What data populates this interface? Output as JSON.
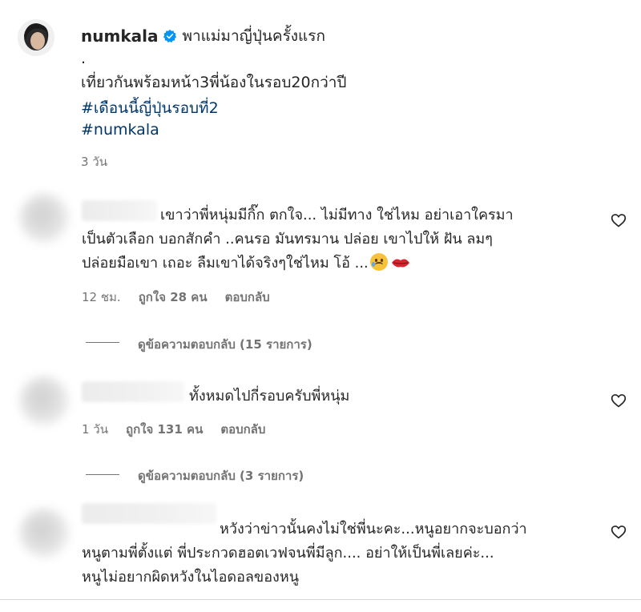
{
  "post": {
    "username": "numkala",
    "title": "พาแม่มาญี่ปุ่นครั้งแรก",
    "dot": ".",
    "caption": "เที่ยวกันพร้อมหน้า3พี่น้องในรอบ20กว่าปี",
    "hashtag1": "#เดือนนี้ญี่ปุ่นรอบที่2",
    "hashtag2": "#numkala",
    "time": "3 วัน"
  },
  "comments": [
    {
      "lines": [
        "เขาว่าพี่หนุ่มมีกิ๊ก ตกใจ... ไม่มีทาง ใช่ไหม อย่าเอาใครมา",
        "เป็นตัวเลือก บอกสักคำ ..คนรอ มันทรมาน ปล่อย เขาไปให้ ฝัน ลมๆ",
        "ปล่อยมือเขา เถอะ ลืมเขาได้จริงๆใช่ไหม โอ้ ..."
      ],
      "time": "12 ชม.",
      "likes": "ถูกใจ 28 คน",
      "reply": "ตอบกลับ",
      "view_replies": "ดูข้อความตอบกลับ (15 รายการ)",
      "emojis": [
        "sad-tear-emoji",
        "lips-emoji"
      ]
    },
    {
      "lines": [
        "ทั้งหมดไปกี่รอบครับพี่หนุ่ม"
      ],
      "time": "1 วัน",
      "likes": "ถูกใจ 131 คน",
      "reply": "ตอบกลับ",
      "view_replies": "ดูข้อความตอบกลับ (3 รายการ)"
    },
    {
      "lines": [
        "หวังว่าข่าวนั้นคงไม่ใช่พี่นะคะ...หนูอยากจะบอกว่า",
        "หนูตามพี่ตั้งแต่ พี่ประกวดฮอตเวฟจนพี่มีลูก.... อย่าให้เป็นพี่เลยค่ะ...",
        "หนูไม่อยากผิดหวังในไอดอลของหนู"
      ]
    }
  ],
  "colors": {
    "text": "#262626",
    "secondary": "#737373",
    "hashtag": "#00376b",
    "verified": "#0095f6"
  }
}
